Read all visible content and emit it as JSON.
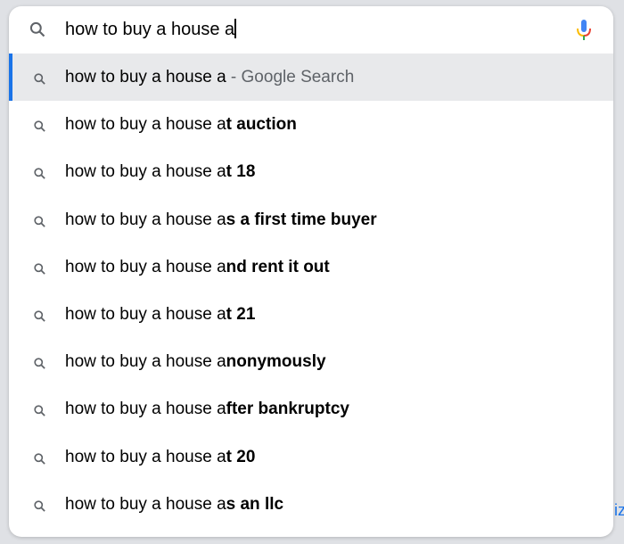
{
  "search": {
    "query": "how to buy a house a"
  },
  "colors": {
    "accent": "#1a73e8",
    "selected_bg": "#e8e9eb"
  },
  "suggestions": [
    {
      "prefix": "how to buy a house a",
      "bold": "",
      "suffix": " - Google Search",
      "selected": true
    },
    {
      "prefix": "how to buy a house a",
      "bold": "t auction"
    },
    {
      "prefix": "how to buy a house a",
      "bold": "t 18"
    },
    {
      "prefix": "how to buy a house a",
      "bold": "s a first time buyer"
    },
    {
      "prefix": "how to buy a house a",
      "bold": "nd rent it out"
    },
    {
      "prefix": "how to buy a house a",
      "bold": "t 21"
    },
    {
      "prefix": "how to buy a house a",
      "bold": "nonymously"
    },
    {
      "prefix": "how to buy a house a",
      "bold": "fter bankruptcy"
    },
    {
      "prefix": "how to buy a house a",
      "bold": "t 20"
    },
    {
      "prefix": "how to buy a house a",
      "bold": "s an llc"
    }
  ],
  "background_peek": "iz"
}
